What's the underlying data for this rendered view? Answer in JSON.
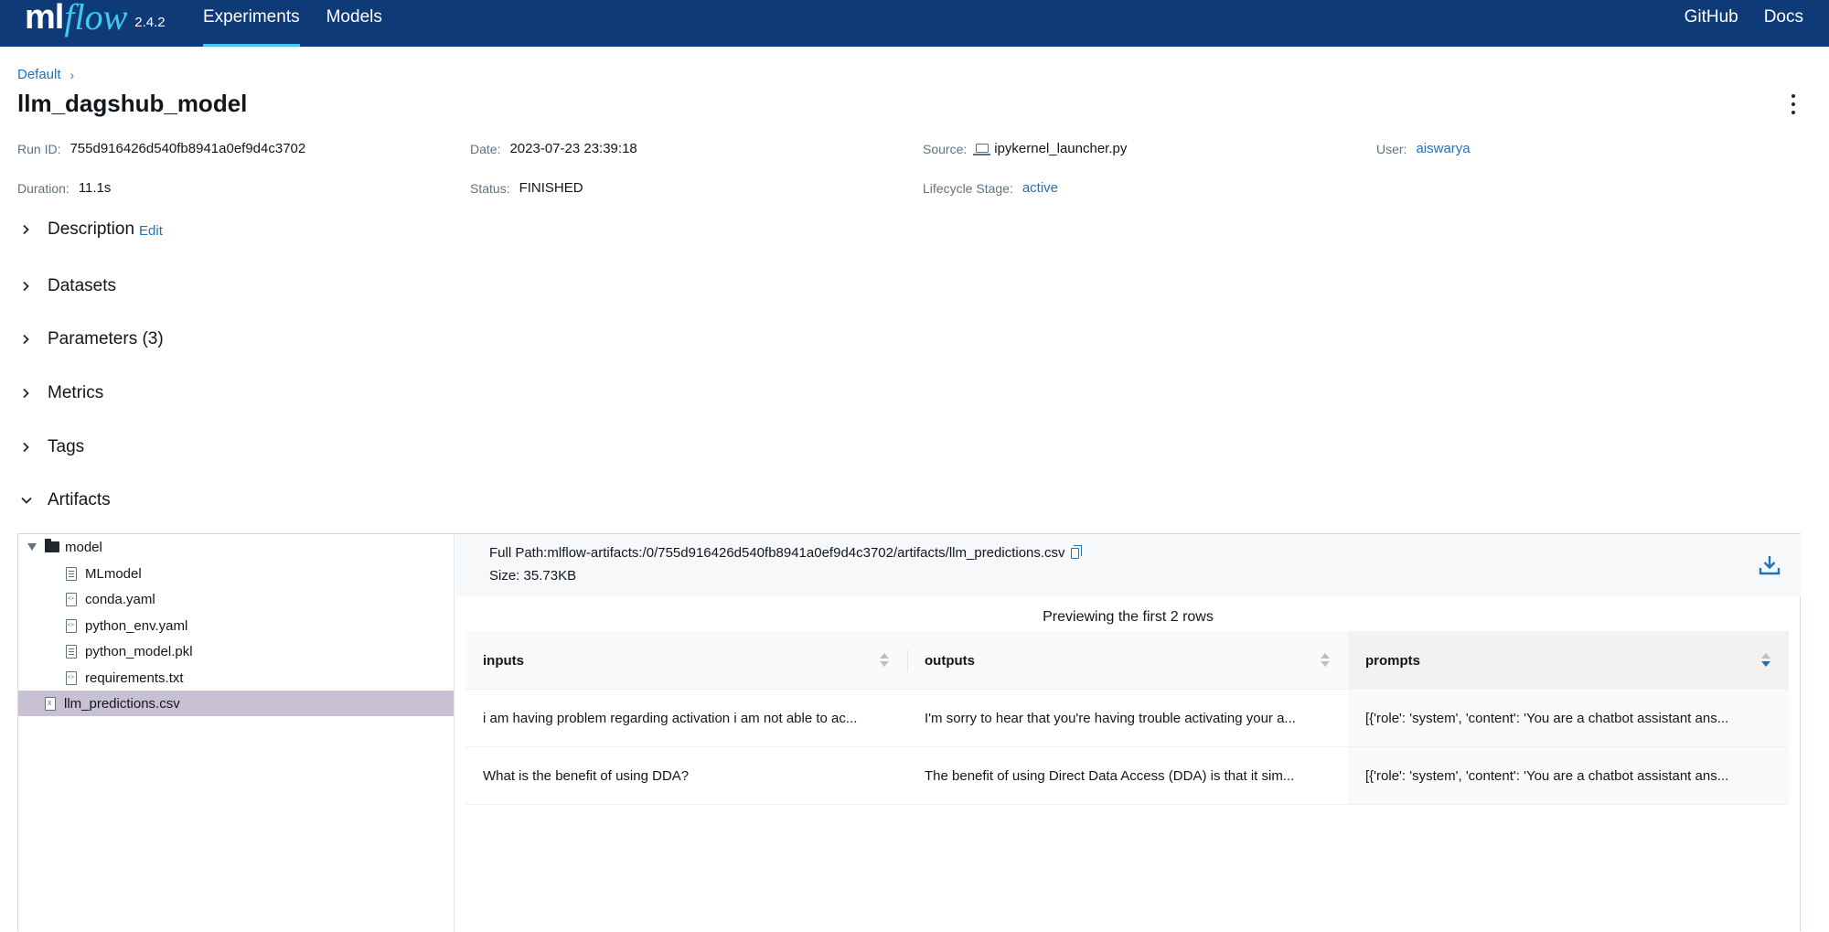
{
  "app": {
    "logo_ml": "ml",
    "logo_flow": "flow",
    "version": "2.4.2",
    "nav": [
      "Experiments",
      "Models"
    ],
    "nav_right": [
      "GitHub",
      "Docs"
    ],
    "accent_color": "#43c9ed",
    "header_color": "#0e3a77",
    "link_color": "#2272b4"
  },
  "breadcrumb": {
    "experiment": "Default",
    "separator": "›"
  },
  "run": {
    "title": "llm_dagshub_model",
    "run_id_label": "Run ID:",
    "run_id": "755d916426d540fb8941a0ef9d4c3702",
    "date_label": "Date:",
    "date": "2023-07-23 23:39:18",
    "source_label": "Source:",
    "source": "ipykernel_launcher.py",
    "source_icon": "laptop-icon",
    "user_label": "User:",
    "user": "aiswarya",
    "duration_label": "Duration:",
    "duration": "11.1s",
    "status_label": "Status:",
    "status": "FINISHED",
    "lifecycle_label": "Lifecycle Stage:",
    "lifecycle": "active"
  },
  "sections": {
    "description": "Description",
    "description_edit": "Edit",
    "datasets": "Datasets",
    "parameters": "Parameters (3)",
    "metrics": "Metrics",
    "tags": "Tags",
    "artifacts": "Artifacts"
  },
  "tree": {
    "folder": "model",
    "files": [
      "MLmodel",
      "conda.yaml",
      "python_env.yaml",
      "python_model.pkl",
      "requirements.txt"
    ],
    "selected_file": "llm_predictions.csv"
  },
  "viewer": {
    "full_path_label": "Full Path:",
    "full_path": "mlflow-artifacts:/0/755d916426d540fb8941a0ef9d4c3702/artifacts/llm_predictions.csv",
    "size_label": "Size:",
    "size": "35.73KB",
    "preview_caption": "Previewing the first 2 rows",
    "columns": [
      "inputs",
      "outputs",
      "prompts"
    ],
    "sorted_column": "prompts",
    "rows": [
      [
        "i am having problem regarding activation i am not able to ac...",
        "I'm sorry to hear that you're having trouble activating your a...",
        "[{'role': 'system', 'content': 'You are a chatbot assistant ans..."
      ],
      [
        "What is the benefit of using DDA?",
        "The benefit of using Direct Data Access (DDA) is that it sim...",
        "[{'role': 'system', 'content': 'You are a chatbot assistant ans..."
      ]
    ]
  }
}
